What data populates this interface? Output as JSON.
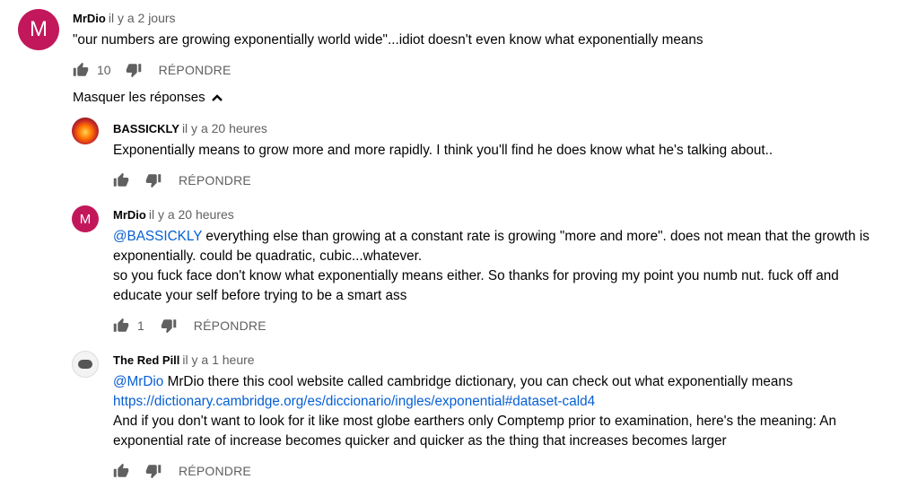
{
  "comment": {
    "avatar_letter": "M",
    "author": "MrDio",
    "time": "il y a 2 jours",
    "text": "\"our numbers are growing exponentially world wide\"...idiot doesn't even know what exponentially means",
    "likes": "10",
    "reply_label": "RÉPONDRE"
  },
  "toggle_label": "Masquer les réponses",
  "replies": [
    {
      "author": "BASSICKLY",
      "time": "il y a 20 heures",
      "lines": [
        "Exponentially means to grow more and more rapidly. I think you'll find he does know what he's talking about.."
      ],
      "likes": "",
      "reply_label": "RÉPONDRE"
    },
    {
      "avatar_letter": "M",
      "author": "MrDio",
      "time": "il y a 20 heures",
      "mention": "@BASSICKLY",
      "line1_rest": " everything else than growing at a constant rate  is growing \"more and more\". does not mean that the growth is",
      "lines": [
        "exponentially. could be quadratic, cubic...whatever.",
        "so you fuck face don't know what exponentially means either. So thanks for proving my point you numb nut. fuck off and",
        "educate your self before trying to be  a smart ass"
      ],
      "likes": "1",
      "reply_label": "RÉPONDRE"
    },
    {
      "author": "The Red Pill",
      "time": "il y a 1 heure",
      "mention": "@MrDio",
      "line1_rest": " MrDio there this cool website called cambridge dictionary, you can check out what exponentially means",
      "url": "https://dictionary.cambridge.org/es/diccionario/ingles/exponential#dataset-cald4",
      "lines": [
        "And if you don't want to look for it like most globe earthers only Comptemp prior to examination, here's the meaning: An",
        "exponential rate of increase becomes quicker and quicker as the thing that increases becomes larger"
      ],
      "likes": "",
      "reply_label": "RÉPONDRE"
    }
  ]
}
